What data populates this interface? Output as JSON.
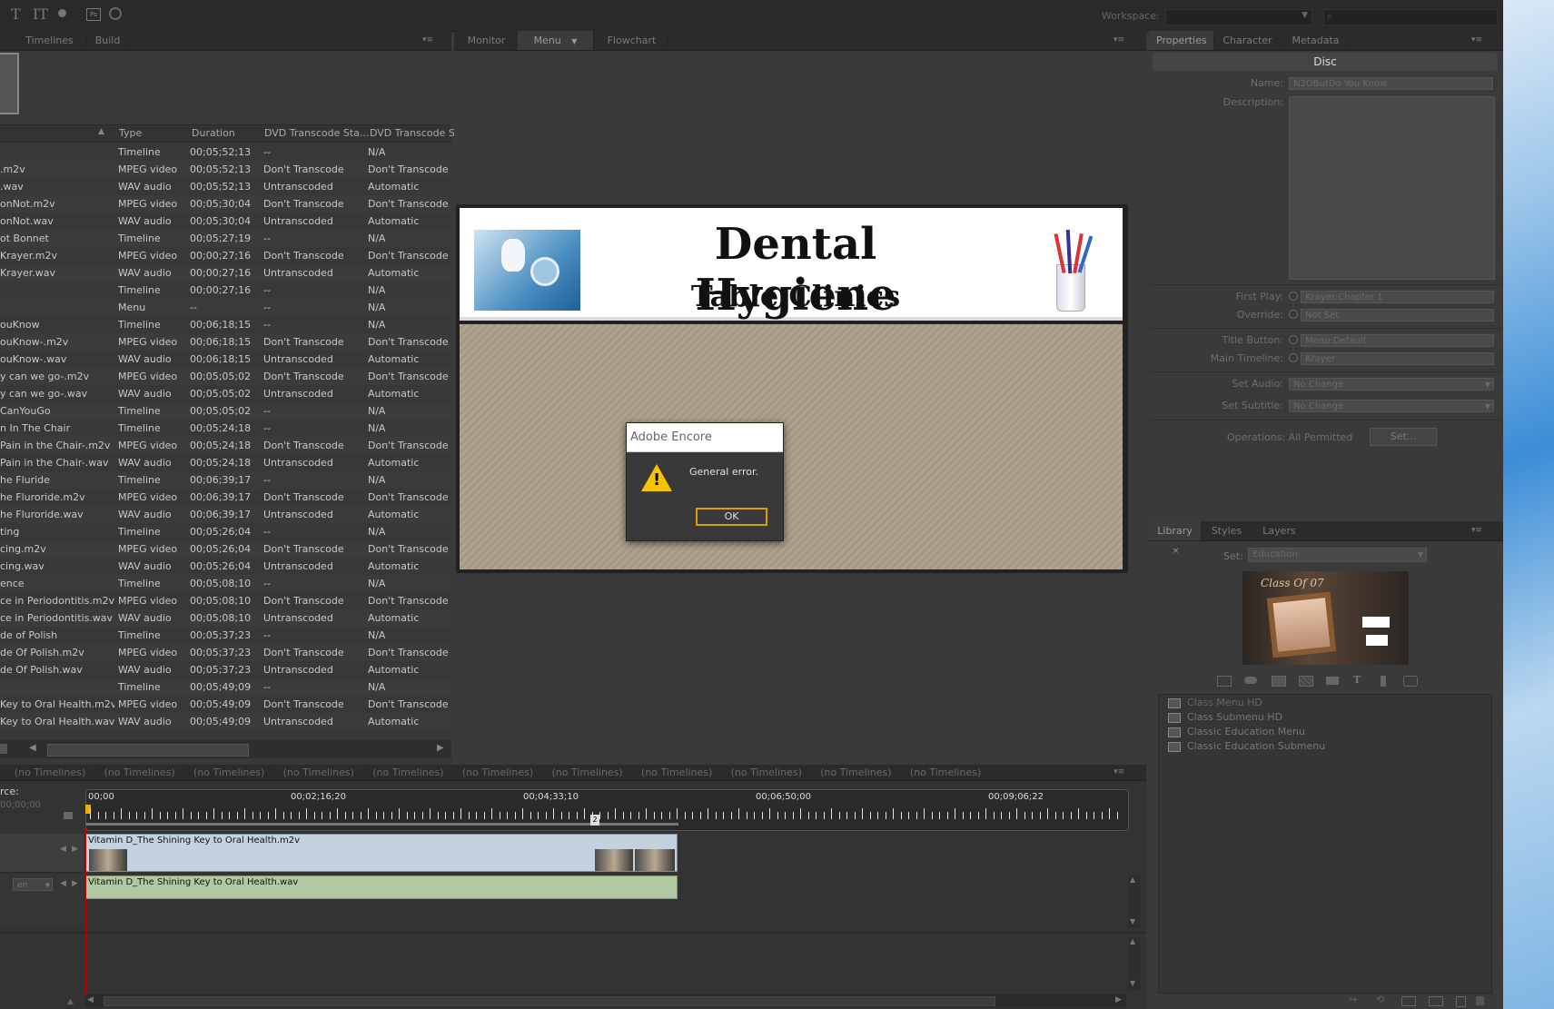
{
  "top_toolbar": {
    "workspace_label": "Workspace:",
    "workspace_value": ""
  },
  "project_panel": {
    "tabs": [
      "Timelines",
      "Build"
    ],
    "columns": [
      "Type",
      "Duration",
      "DVD Transcode Sta...",
      "DVD Transcode S"
    ],
    "rows": [
      {
        "name": "",
        "type": "Timeline",
        "duration": "00;05;52;13",
        "status": "--",
        "setting": "N/A"
      },
      {
        "name": ".m2v",
        "type": "MPEG video",
        "duration": "00;05;52;13",
        "status": "Don't Transcode",
        "setting": "Don't Transcode"
      },
      {
        "name": ".wav",
        "type": "WAV audio",
        "duration": "00;05;52;13",
        "status": "Untranscoded",
        "setting": "Automatic"
      },
      {
        "name": "onNot.m2v",
        "type": "MPEG video",
        "duration": "00;05;30;04",
        "status": "Don't Transcode",
        "setting": "Don't Transcode"
      },
      {
        "name": "onNot.wav",
        "type": "WAV audio",
        "duration": "00;05;30;04",
        "status": "Untranscoded",
        "setting": "Automatic"
      },
      {
        "name": "ot Bonnet",
        "type": "Timeline",
        "duration": "00;05;27;19",
        "status": "--",
        "setting": "N/A"
      },
      {
        "name": "Krayer.m2v",
        "type": "MPEG video",
        "duration": "00;00;27;16",
        "status": "Don't Transcode",
        "setting": "Don't Transcode"
      },
      {
        "name": "Krayer.wav",
        "type": "WAV audio",
        "duration": "00;00;27;16",
        "status": "Untranscoded",
        "setting": "Automatic"
      },
      {
        "name": "",
        "type": "Timeline",
        "duration": "00;00;27;16",
        "status": "--",
        "setting": "N/A"
      },
      {
        "name": "",
        "type": "Menu",
        "duration": "--",
        "status": "--",
        "setting": "N/A"
      },
      {
        "name": "ouKnow",
        "type": "Timeline",
        "duration": "00;06;18;15",
        "status": "--",
        "setting": "N/A"
      },
      {
        "name": "ouKnow-.m2v",
        "type": "MPEG video",
        "duration": "00;06;18;15",
        "status": "Don't Transcode",
        "setting": "Don't Transcode"
      },
      {
        "name": "ouKnow-.wav",
        "type": "WAV audio",
        "duration": "00;06;18;15",
        "status": "Untranscoded",
        "setting": "Automatic"
      },
      {
        "name": "y can we go-.m2v",
        "type": "MPEG video",
        "duration": "00;05;05;02",
        "status": "Don't Transcode",
        "setting": "Don't Transcode"
      },
      {
        "name": "y can we go-.wav",
        "type": "WAV audio",
        "duration": "00;05;05;02",
        "status": "Untranscoded",
        "setting": "Automatic"
      },
      {
        "name": "CanYouGo",
        "type": "Timeline",
        "duration": "00;05;05;02",
        "status": "--",
        "setting": "N/A"
      },
      {
        "name": "n In The Chair",
        "type": "Timeline",
        "duration": "00;05;24;18",
        "status": "--",
        "setting": "N/A"
      },
      {
        "name": "Pain in the Chair-.m2v",
        "type": "MPEG video",
        "duration": "00;05;24;18",
        "status": "Don't Transcode",
        "setting": "Don't Transcode"
      },
      {
        "name": "Pain in the Chair-.wav",
        "type": "WAV audio",
        "duration": "00;05;24;18",
        "status": "Untranscoded",
        "setting": "Automatic"
      },
      {
        "name": "he Fluride",
        "type": "Timeline",
        "duration": "00;06;39;17",
        "status": "--",
        "setting": "N/A"
      },
      {
        "name": "he Fluroride.m2v",
        "type": "MPEG video",
        "duration": "00;06;39;17",
        "status": "Don't Transcode",
        "setting": "Don't Transcode"
      },
      {
        "name": "he Fluroride.wav",
        "type": "WAV audio",
        "duration": "00;06;39;17",
        "status": "Untranscoded",
        "setting": "Automatic"
      },
      {
        "name": "ting",
        "type": "Timeline",
        "duration": "00;05;26;04",
        "status": "--",
        "setting": "N/A"
      },
      {
        "name": "cing.m2v",
        "type": "MPEG video",
        "duration": "00;05;26;04",
        "status": "Don't Transcode",
        "setting": "Don't Transcode"
      },
      {
        "name": "cing.wav",
        "type": "WAV audio",
        "duration": "00;05;26;04",
        "status": "Untranscoded",
        "setting": "Automatic"
      },
      {
        "name": "ence",
        "type": "Timeline",
        "duration": "00;05;08;10",
        "status": "--",
        "setting": "N/A"
      },
      {
        "name": "ce in Periodontitis.m2v",
        "type": "MPEG video",
        "duration": "00;05;08;10",
        "status": "Don't Transcode",
        "setting": "Don't Transcode"
      },
      {
        "name": "ce in Periodontitis.wav",
        "type": "WAV audio",
        "duration": "00;05;08;10",
        "status": "Untranscoded",
        "setting": "Automatic"
      },
      {
        "name": "de of Polish",
        "type": "Timeline",
        "duration": "00;05;37;23",
        "status": "--",
        "setting": "N/A"
      },
      {
        "name": "de Of Polish.m2v",
        "type": "MPEG video",
        "duration": "00;05;37;23",
        "status": "Don't Transcode",
        "setting": "Don't Transcode"
      },
      {
        "name": "de Of Polish.wav",
        "type": "WAV audio",
        "duration": "00;05;37;23",
        "status": "Untranscoded",
        "setting": "Automatic"
      },
      {
        "name": "",
        "type": "Timeline",
        "duration": "00;05;49;09",
        "status": "--",
        "setting": "N/A"
      },
      {
        "name": "Key to Oral Health.m2v",
        "type": "MPEG video",
        "duration": "00;05;49;09",
        "status": "Don't Transcode",
        "setting": "Don't Transcode"
      },
      {
        "name": "Key to Oral Health.wav",
        "type": "WAV audio",
        "duration": "00;05;49;09",
        "status": "Untranscoded",
        "setting": "Automatic"
      }
    ]
  },
  "viewer_panel": {
    "tabs": [
      "Monitor",
      "Menu",
      "Flowchart"
    ],
    "banner_title": "Dental Hygiene",
    "banner_subtitle": "Table Clinics"
  },
  "dialog": {
    "title": "Adobe Encore",
    "message": "General error.",
    "ok_label": "OK"
  },
  "properties_panel": {
    "tabs": [
      "Properties",
      "Character",
      "Metadata"
    ],
    "header": "Disc",
    "name_label": "Name:",
    "name_value": "N2OButDo You Know",
    "description_label": "Description:",
    "first_play_label": "First Play:",
    "first_play_value": "Krayer:Chapter 1",
    "override_label": "Override:",
    "override_value": "Not Set",
    "title_button_label": "Title Button:",
    "title_button_value": "Menu:Default",
    "main_timeline_label": "Main Timeline:",
    "main_timeline_value": "Krayer",
    "set_audio_label": "Set Audio:",
    "set_audio_value": "No Change",
    "set_subtitle_label": "Set Subtitle:",
    "set_subtitle_value": "No Change",
    "operations_label": "Operations: All Permitted",
    "set_button": "Set..."
  },
  "library_panel": {
    "tabs": [
      "Library",
      "Styles",
      "Layers"
    ],
    "set_label": "Set:",
    "set_value": "Education",
    "items": [
      "Class Menu HD",
      "Class Submenu HD",
      "Classic Education Menu",
      "Classic Education Submenu"
    ]
  },
  "timeline_panel": {
    "tabs": [
      "(no Timelines)",
      "(no Timelines)",
      "(no Timelines)",
      "(no Timelines)",
      "(no Timelines)",
      "(no Timelines)",
      "(no Timelines)",
      "(no Timelines)",
      "(no Timelines)",
      "(no Timelines)",
      "(no Timelines)"
    ],
    "source_label": "rce:",
    "current_time": "00;00;00",
    "ruler_labels": [
      "00;00",
      "00;02;16;20",
      "00;04;33;10",
      "00;06;50;00",
      "00;09;06;22"
    ],
    "video_clip": "Vitamin D_The Shining Key to Oral Health.m2v",
    "audio_clip": "Vitamin D_The Shining Key to Oral Health.wav",
    "audio_lang": "en",
    "chapter_marker": "2"
  }
}
